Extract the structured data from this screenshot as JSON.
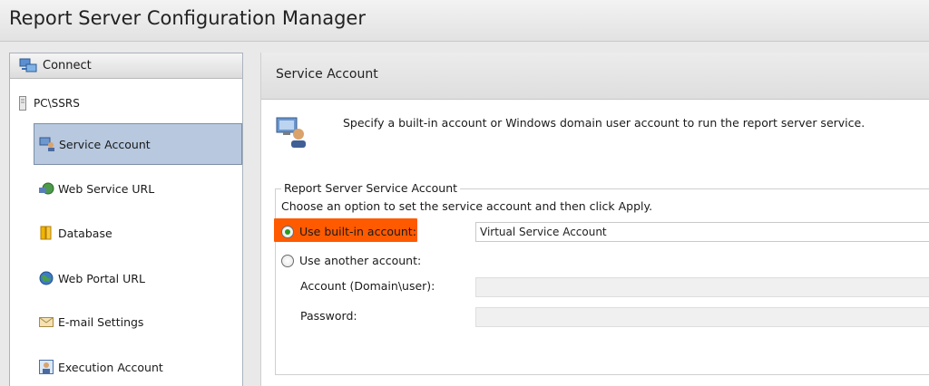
{
  "window": {
    "title": "Report Server Configuration Manager"
  },
  "sidebar": {
    "connect_label": "Connect",
    "server": "PC\\SSRS",
    "items": [
      {
        "label": "Service Account",
        "icon": "service-account-icon",
        "selected": true
      },
      {
        "label": "Web Service URL",
        "icon": "web-service-url-icon",
        "selected": false
      },
      {
        "label": "Database",
        "icon": "database-icon",
        "selected": false
      },
      {
        "label": "Web Portal URL",
        "icon": "globe-icon",
        "selected": false
      },
      {
        "label": "E-mail Settings",
        "icon": "email-icon",
        "selected": false
      },
      {
        "label": "Execution Account",
        "icon": "execution-account-icon",
        "selected": false
      }
    ]
  },
  "main": {
    "header_title": "Service Account",
    "intro": "Specify a built-in account or Windows domain user account to run the report server service.",
    "group": {
      "legend": "Report Server Service Account",
      "description": "Choose an option to set the service account and then click Apply.",
      "builtin_label": "Use built-in account:",
      "builtin_value": "Virtual Service Account",
      "another_label": "Use another account:",
      "account_label": "Account (Domain\\user):",
      "account_value": "",
      "password_label": "Password:",
      "password_value": ""
    }
  },
  "colors": {
    "highlight": "#ff5a00",
    "selection": "#b7c8df",
    "radio_checked": "#2a9a1e"
  }
}
